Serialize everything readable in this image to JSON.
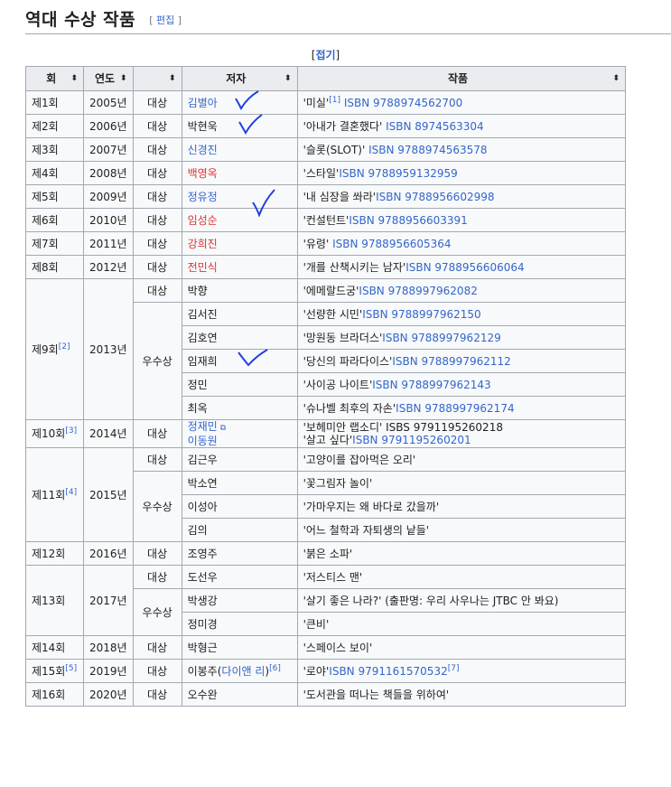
{
  "section": {
    "title": "역대 수상 작품",
    "edit": "편집"
  },
  "table": {
    "toggle": "접기",
    "headers": [
      "회",
      "연도",
      "",
      "저자",
      "작품"
    ],
    "rows": [
      {
        "n": "제1회",
        "y": "2005년",
        "c": "대상",
        "a": "김별아",
        "ac": "blue",
        "w": "'미실'",
        "wsup": "[1]",
        "wisbn": " ISBN 9788974562700"
      },
      {
        "n": "제2회",
        "y": "2006년",
        "c": "대상",
        "a": "박현욱",
        "ac": "",
        "w": "'아내가 결혼했다'",
        "wisbn": " ISBN 8974563304"
      },
      {
        "n": "제3회",
        "y": "2007년",
        "c": "대상",
        "a": "신경진",
        "ac": "blue",
        "w": "'슬롯(SLOT)'",
        "wisbn": " ISBN 9788974563578"
      },
      {
        "n": "제4회",
        "y": "2008년",
        "c": "대상",
        "a": "백영옥",
        "ac": "red",
        "w": "'스타일'",
        "wisbn": "ISBN 9788959132959"
      },
      {
        "n": "제5회",
        "y": "2009년",
        "c": "대상",
        "a": "정유정",
        "ac": "blue",
        "w": "'내 심장을 쏴라'",
        "wisbn": "ISBN 9788956602998"
      },
      {
        "n": "제6회",
        "y": "2010년",
        "c": "대상",
        "a": "임성순",
        "ac": "red",
        "w": "'컨설턴트'",
        "wisbn": "ISBN 9788956603391"
      },
      {
        "n": "제7회",
        "y": "2011년",
        "c": "대상",
        "a": "강희진",
        "ac": "red",
        "w": "'유령'",
        "wisbn": " ISBN 9788956605364"
      },
      {
        "n": "제8회",
        "y": "2012년",
        "c": "대상",
        "a": "전민식",
        "ac": "red",
        "w": "'개를 산책시키는 남자'",
        "wisbn": "ISBN 9788956606064"
      }
    ],
    "group9": {
      "n": "제9회",
      "nsup": "[2]",
      "y": "2013년",
      "grand": {
        "c": "대상",
        "a": "박향",
        "w": "'에메랄드궁'",
        "wisbn": "ISBN 9788997962082"
      },
      "excellence_label": "우수상",
      "excellence": [
        {
          "a": "김서진",
          "w": "'선량한 시민'",
          "wisbn": "ISBN 9788997962150"
        },
        {
          "a": "김호연",
          "w": "'망원동 브라더스'",
          "wisbn": "ISBN 9788997962129"
        },
        {
          "a": "임재희",
          "w": "'당신의 파라다이스'",
          "wisbn": "ISBN 9788997962112"
        },
        {
          "a": "정민",
          "w": "'사이공 나이트'",
          "wisbn": "ISBN 9788997962143"
        },
        {
          "a": "최옥",
          "w": "'슈나벨 최후의 자손'",
          "wisbn": "ISBN 9788997962174"
        }
      ]
    },
    "row10": {
      "n": "제10회",
      "nsup": "[3]",
      "y": "2014년",
      "c": "대상",
      "a1": "정재민",
      "a2": "이동원",
      "w1": "'보헤미안 랩소디' ISBS 9791195260218",
      "w2": "'살고 싶다'",
      "w2isbn": "ISBN 9791195260201"
    },
    "group11": {
      "n": "제11회",
      "nsup": "[4]",
      "y": "2015년",
      "grand": {
        "c": "대상",
        "a": "김근우",
        "w": "'고양이를 잡아먹은 오리'"
      },
      "excellence_label": "우수상",
      "excellence": [
        {
          "a": "박소연",
          "w": "'꽃그림자 놀이'"
        },
        {
          "a": "이성아",
          "w": "'가마우지는 왜 바다로 갔을까'"
        },
        {
          "a": "김의",
          "w": "'어느 철학과 자퇴생의 낱들'"
        }
      ]
    },
    "row12": {
      "n": "제12회",
      "y": "2016년",
      "c": "대상",
      "a": "조영주",
      "w": "'붉은 소파'"
    },
    "group13": {
      "n": "제13회",
      "y": "2017년",
      "grand": {
        "c": "대상",
        "a": "도선우",
        "w": "'저스티스 맨'"
      },
      "excellence_label": "우수상",
      "excellence": [
        {
          "a": "박생강",
          "w": "'살기 좋은 나라?' (출판명: 우리 사우나는 JTBC 안 봐요)"
        },
        {
          "a": "정미경",
          "w": "'큰비'"
        }
      ]
    },
    "row14": {
      "n": "제14회",
      "y": "2018년",
      "c": "대상",
      "a": "박형근",
      "w": "'스페이스 보이'"
    },
    "row15": {
      "n": "제15회",
      "nsup": "[5]",
      "y": "2019년",
      "c": "대상",
      "a": "이봉주(",
      "alink": "다이앤 리",
      "aclose": ")",
      "asup": "[6]",
      "w": "'로야'",
      "wisbn": "ISBN 9791161570532",
      "wsup": "[7]"
    },
    "row16": {
      "n": "제16회",
      "y": "2020년",
      "c": "대상",
      "a": "오수완",
      "w": "'도서관을 떠나는 책들을 위하여'"
    }
  }
}
